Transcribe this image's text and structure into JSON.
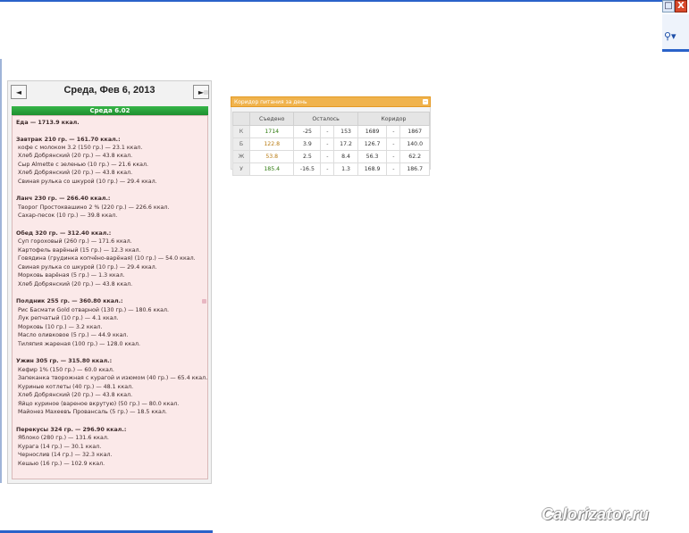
{
  "window": {
    "controls": [
      "□",
      "X"
    ],
    "search_icon": "search-icon"
  },
  "day": {
    "prev": "◄",
    "title": "Среда, Фев 6, 2013",
    "next": "►",
    "tab": "Среда 6.02"
  },
  "food": {
    "total": "Еда — 1713.9 ккал.",
    "meals": [
      {
        "head": "Завтрак 210 гр. — 161.70 ккал.:",
        "items": [
          "кофе с молоком 3.2 (150 гр.) — 23.1 ккал.",
          "Хлеб Добрянский (20 гр.) — 43.8 ккал.",
          "Сыр Almette с зеленью (10 гр.) — 21.6 ккал.",
          "Хлеб Добрянский (20 гр.) — 43.8 ккал.",
          "Свиная рулька со шкурой (10 гр.) — 29.4 ккал."
        ]
      },
      {
        "head": "Ланч 230 гр. — 266.40 ккал.:",
        "items": [
          "Творог Простоквашино 2 % (220 гр.) — 226.6 ккал.",
          "Сахар-песок (10 гр.) — 39.8 ккал."
        ]
      },
      {
        "head": "Обед 320 гр. — 312.40 ккал.:",
        "items": [
          "Суп гороховый (260 гр.) — 171.6 ккал.",
          "Картофель варёный (15 гр.) — 12.3 ккал.",
          "Говядина (грудинка копчёно-варёная) (10 гр.) — 54.0 ккал.",
          "Свиная рулька со шкурой (10 гр.) — 29.4 ккал.",
          "Морковь варёная (5 гр.) — 1.3 ккал.",
          "Хлеб Добрянский (20 гр.) — 43.8 ккал."
        ]
      },
      {
        "head": "Полдник 255 гр. — 360.80 ккал.:",
        "items": [
          "Рис Басмати Gold отварной (130 гр.) — 180.6 ккал.",
          "Лук репчатый (10 гр.) — 4.1 ккал.",
          "Морковь (10 гр.) — 3.2 ккал.",
          "Масло оливковое (5 гр.) — 44.9 ккал.",
          "Тиляпия жареная (100 гр.) — 128.0 ккал."
        ]
      },
      {
        "head": "Ужин 305 гр. — 315.80 ккал.:",
        "items": [
          "Кефир 1% (150 гр.) — 60.0 ккал.",
          "Запеканка творожная с курагой и изюмом (40 гр.) — 65.4 ккал.",
          "Куриные котлеты (40 гр.) — 48.1 ккал.",
          "Хлеб Добрянский (20 гр.) — 43.8 ккал.",
          "Яйцо куриное (вареное вкрутую) (50 гр.) — 80.0 ккал.",
          "Майонез Махеевъ Провансаль (5 гр.) — 18.5 ккал."
        ]
      },
      {
        "head": "Перекусы 324 гр. — 296.90 ккал.:",
        "items": [
          "Яблоко (280 гр.) — 131.6 ккал.",
          "Курага (14 гр.) — 30.1 ккал.",
          "Чернослив (14 гр.) — 32.3 ккал.",
          "Кешью (16 гр.) — 102.9 ккал."
        ]
      }
    ]
  },
  "corridor": {
    "title": "Коридор питания за день",
    "close": "−",
    "headers": [
      "Съедено",
      "Осталось",
      "Коридор"
    ],
    "rows": [
      {
        "label": "К",
        "eaten": "1714",
        "left_from": "-25",
        "left_to": "153",
        "corr_from": "1689",
        "corr_to": "1867"
      },
      {
        "label": "Б",
        "eaten": "122.8",
        "left_from": "3.9",
        "left_to": "17.2",
        "corr_from": "126.7",
        "corr_to": "140.0"
      },
      {
        "label": "Ж",
        "eaten": "53.8",
        "left_from": "2.5",
        "left_to": "8.4",
        "corr_from": "56.3",
        "corr_to": "62.2"
      },
      {
        "label": "У",
        "eaten": "185.4",
        "left_from": "-16.5",
        "left_to": "1.3",
        "corr_from": "168.9",
        "corr_to": "186.7"
      }
    ]
  },
  "watermark": "Calorizator.ru"
}
